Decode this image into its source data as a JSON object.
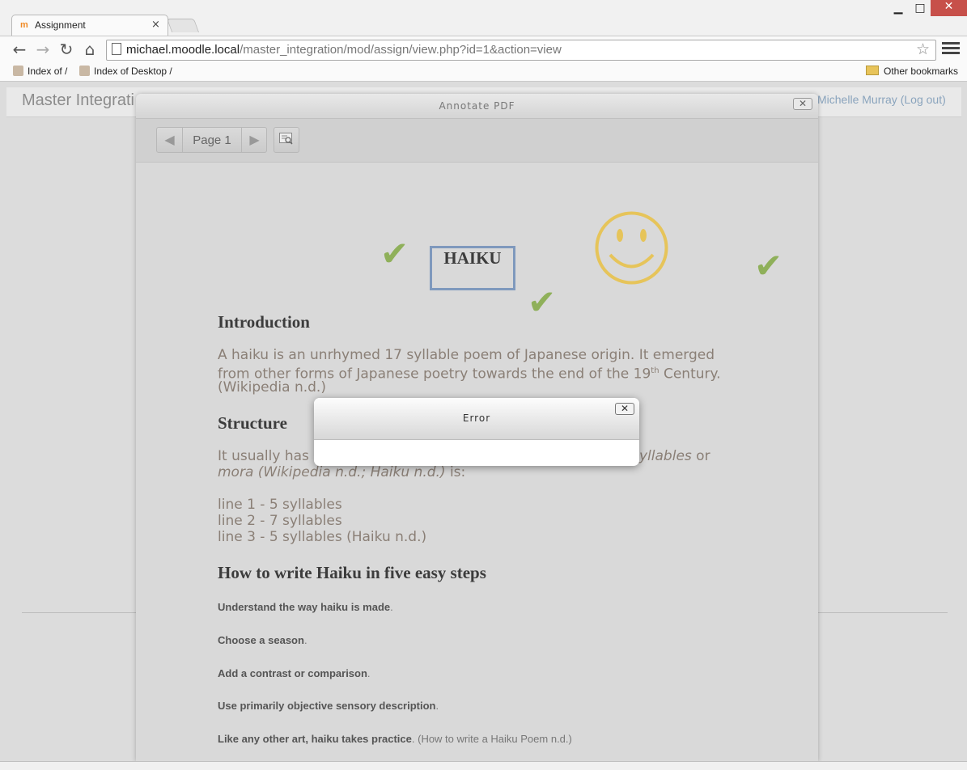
{
  "browser": {
    "tab_title": "Assignment",
    "tab_icon": "m",
    "close_glyph": "×",
    "url_host": "michael.moodle.local",
    "url_path": "/master_integration/mod/assign/view.php?id=1&action=view",
    "bookmarks": [
      "Index of /",
      "Index of Desktop /"
    ],
    "other_bookmarks": "Other bookmarks",
    "window_controls": {
      "minimize": "▁",
      "maximize": "□",
      "close": "✕"
    },
    "nav": {
      "back": "←",
      "forward": "→",
      "reload": "↻",
      "home": "⌂",
      "star": "☆"
    }
  },
  "moodle": {
    "site_name": "Master Integrati",
    "user_name": "Michelle Murray",
    "logout_link": "Log out"
  },
  "annotate": {
    "title": "Annotate PDF",
    "page_label": "Page 1",
    "prev_glyph": "◀",
    "next_glyph": "▶",
    "close_glyph": "✕",
    "annotations": {
      "checkmark": "✔",
      "stamp": "smiley-face",
      "stamp_color": "#e6c45a",
      "check_color": "#8fb05a",
      "frame_color": "#7f99bd"
    },
    "doc": {
      "heading_box": "HAIKU",
      "intro_heading": "Introduction",
      "intro_l1": "A haiku is an unrhymed 17 syllable poem of Japanese origin. It emerged",
      "intro_l2": "from other forms of Japanese poetry towards the end of the 19",
      "intro_sup": "th",
      "intro_l2_end": " Century.",
      "intro_l3": "(Wikipedia n.d.)",
      "structure_heading": "Structure",
      "structure_l1_start": "It usually has",
      "structure_l1_end_italic": "yllables",
      "structure_l1_or": " or",
      "structure_l2_italic": "mora (Wikipedia n.d.; Haiku n.d.)",
      "structure_l2_end": " is:",
      "lines": [
        "line 1 - 5 syllables",
        "line 2 - 7 syllables",
        "line 3 - 5 syllables (Haiku n.d.)"
      ],
      "steps_heading": "How to write Haiku in five easy steps",
      "steps": [
        {
          "bold": "Understand the way haiku is made",
          "plain": "."
        },
        {
          "bold": "Choose a season",
          "plain": "."
        },
        {
          "bold": "Add a contrast or comparison",
          "plain": "."
        },
        {
          "bold": "Use primarily objective sensory description",
          "plain": "."
        },
        {
          "bold": "Like any other art, haiku takes practice",
          "plain": ".  (How to write a Haiku Poem n.d.)"
        }
      ]
    }
  },
  "error_dialog": {
    "title": "Error",
    "close_glyph": "✕"
  }
}
